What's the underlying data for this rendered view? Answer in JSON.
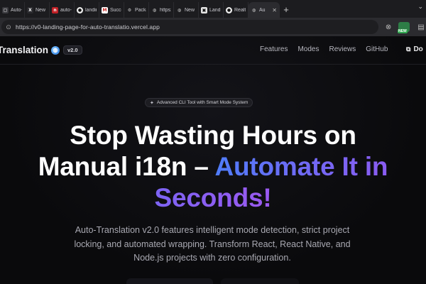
{
  "browser": {
    "tabs": [
      {
        "title": "Auto-T",
        "icon": "bookmark-icon",
        "color": "#3a3a3f"
      },
      {
        "title": "New P",
        "icon": "ex-icon",
        "color": "#444"
      },
      {
        "title": "auto-t",
        "icon": "npm-icon",
        "color": "#c12127"
      },
      {
        "title": "landing",
        "icon": "github-icon",
        "color": "#555"
      },
      {
        "title": "Succes",
        "icon": "gmail-icon",
        "color": "#c5221f"
      },
      {
        "title": "Packag",
        "icon": "gear-icon",
        "color": "#555"
      },
      {
        "title": "https:/",
        "icon": "globe-icon",
        "color": "#555"
      },
      {
        "title": "New T",
        "icon": "globe-icon",
        "color": "#555"
      },
      {
        "title": "Landi",
        "icon": "landing-icon",
        "color": "#e6e6e6"
      },
      {
        "title": "Realtie",
        "icon": "github-icon",
        "color": "#555"
      },
      {
        "title": "Au",
        "icon": "globe-icon",
        "color": "#555",
        "active": true
      }
    ],
    "new_tab_label": "+",
    "url": "https://v0-landing-page-for-auto-translatio.vercel.app",
    "extension_badge": "NEW"
  },
  "site": {
    "brand": "Translation",
    "version": "v2.0",
    "nav": [
      "Features",
      "Modes",
      "Reviews",
      "GitHub"
    ],
    "nav_cta": "Do",
    "badge": "Advanced CLI Tool with Smart Mode System",
    "hero": {
      "line1": "Stop Wasting Hours on",
      "line2_plain": "Manual i18n – ",
      "line2_accent": "Automate It in",
      "line3_accent": "Seconds!"
    },
    "description": "Auto-Translation v2.0 features intelligent mode detection, strict project locking, and automated wrapping. Transform React, React Native, and Node.js projects with zero configuration."
  },
  "colors": {
    "accent_start": "#4f7dfb",
    "accent_end": "#9b59f0",
    "background": "#0b0b0d"
  }
}
